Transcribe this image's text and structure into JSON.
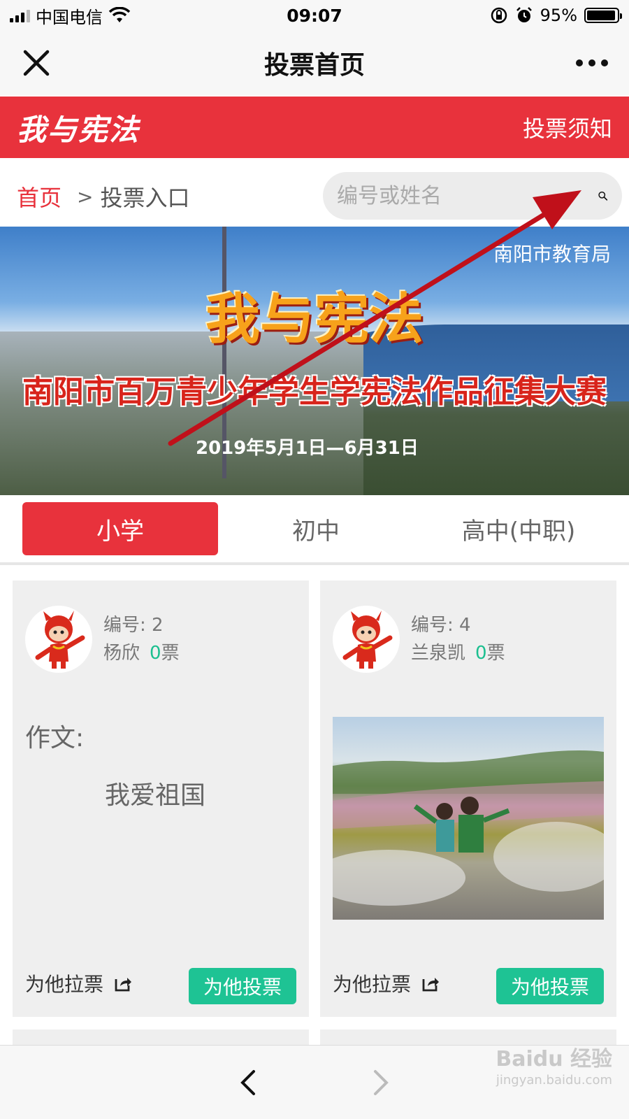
{
  "status_bar": {
    "carrier": "中国电信",
    "time": "09:07",
    "battery_percent": "95%",
    "battery_level": 0.95,
    "icons": [
      "signal-icon",
      "wifi-icon",
      "orientation-lock-icon",
      "alarm-icon",
      "battery-icon"
    ]
  },
  "nav_bar": {
    "title": "投票首页",
    "close_icon": "close-icon",
    "more_icon": "more-icon"
  },
  "header": {
    "logo": "我与宪法",
    "notice_link": "投票须知",
    "bg_color": "#e8323c"
  },
  "breadcrumb": {
    "home": "首页",
    "separator": ">",
    "current": "投票入口"
  },
  "search": {
    "placeholder": "编号或姓名",
    "value": "",
    "icon": "search-icon"
  },
  "banner": {
    "org": "南阳市教育局",
    "title": "我与宪法",
    "subtitle": "南阳市百万青少年学生学宪法作品征集大赛",
    "date": "2019年5月1日—6月31日"
  },
  "tabs": [
    {
      "label": "小学",
      "active": true
    },
    {
      "label": "初中",
      "active": false
    },
    {
      "label": "高中(中职)",
      "active": false
    }
  ],
  "cards": [
    {
      "id_label": "编号: 2",
      "name": "杨欣",
      "votes": "0",
      "votes_unit": "票",
      "work_type": "作文:",
      "work_title": "我爱祖国",
      "share_label": "为他拉票",
      "vote_button": "为他投票"
    },
    {
      "id_label": "编号: 4",
      "name": "兰泉凯",
      "votes": "0",
      "votes_unit": "票",
      "share_label": "为他拉票",
      "vote_button": "为他投票"
    }
  ],
  "bottom_bar": {
    "back_icon": "chevron-left-icon",
    "forward_icon": "chevron-right-icon"
  },
  "watermark": {
    "brand": "Baidu 经验",
    "url": "jingyan.baidu.com"
  },
  "colors": {
    "accent_red": "#e8323c",
    "vote_green": "#1ec394",
    "vote_count_green": "#1bbf8f",
    "annotation_arrow": "#c0101a"
  }
}
